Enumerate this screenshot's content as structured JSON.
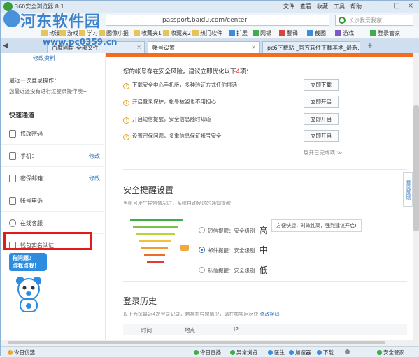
{
  "window": {
    "app_title": "360安全浏览器 8.1",
    "menu": [
      "文件",
      "查看",
      "收藏",
      "工具",
      "帮助"
    ]
  },
  "address": {
    "url": "passport.baidu.com/center",
    "search_placeholder": "长沙我爱我家"
  },
  "favorites": [
    "动漫",
    "游戏",
    "学习",
    "图像小报",
    "收藏夹1",
    "收藏夹2",
    "热门软件",
    "扩展",
    "网银",
    "翻译",
    "截图",
    "游戏",
    "登录管家"
  ],
  "tabs": [
    {
      "label": "百度网盘-全部文件"
    },
    {
      "label": "帐号设置"
    },
    {
      "label": "pc6下载站 _官方软件下载基地_最新..."
    }
  ],
  "watermark": {
    "title": "河东软件园",
    "url": "www.pc0359.cn"
  },
  "sidebar": {
    "edit_profile": "修改资料",
    "last_login_title": "最近一次登录操作：",
    "last_login_text": "您最近还没有进行过登录操作噢~",
    "section_title": "快速通道",
    "items": [
      {
        "label": "修改密码",
        "action": ""
      },
      {
        "label": "手机：",
        "action": "修改"
      },
      {
        "label": "密保邮箱：",
        "action": "修改"
      },
      {
        "label": "帐号申诉",
        "action": ""
      },
      {
        "label": "在线客服",
        "action": ""
      },
      {
        "label": "钱包实名认证",
        "action": ""
      }
    ],
    "help_bubble": "有问题?\n点我点我!"
  },
  "main": {
    "warning_prefix": "您的帐号存在安全风险，建议立即优化以下",
    "warning_count": "4",
    "warning_suffix": "项：",
    "risks": [
      {
        "text": "下载安全中心手机版，多种验证方式任你挑选",
        "button": "立即下载"
      },
      {
        "text": "开启登录保护，帐号被盗也不用担心",
        "button": "立即开启"
      },
      {
        "text": "开启短信提醒，安全信息随时知道",
        "button": "立即开启"
      },
      {
        "text": "设置密保问题，多重信息保证帐号安全",
        "button": "立即开启"
      }
    ],
    "expand_text": "展开已完成项 ≫",
    "alert_title": "安全提醒设置",
    "alert_sub": "当帐号发生异常情况时，系统自动发送的通知提醒",
    "levels": [
      {
        "label": "短信提醒：安全级别",
        "grade": "高",
        "selected": false
      },
      {
        "label": "邮件提醒：安全级别",
        "grade": "中",
        "selected": true
      },
      {
        "label": "私信提醒：安全级别",
        "grade": "低",
        "selected": false
      }
    ],
    "tip": "方便快捷，时效性高，强烈建议开启!",
    "feedback": "意见反馈",
    "history_title": "登录历史",
    "history_sub": "以下为您最近4次登录记录，若存在异常情况，请在核实后尽快",
    "history_link": "修改密码",
    "columns": [
      "时间",
      "地点",
      "IP"
    ]
  },
  "status": {
    "left": "今日优选",
    "items": [
      "今日直播",
      "异常浏览",
      "医生",
      "加速器",
      "下载",
      "",
      "安全管家"
    ]
  },
  "colors": {
    "accent": "#f36d21",
    "link": "#2e6fb8",
    "highlight": "#e41b1b"
  }
}
